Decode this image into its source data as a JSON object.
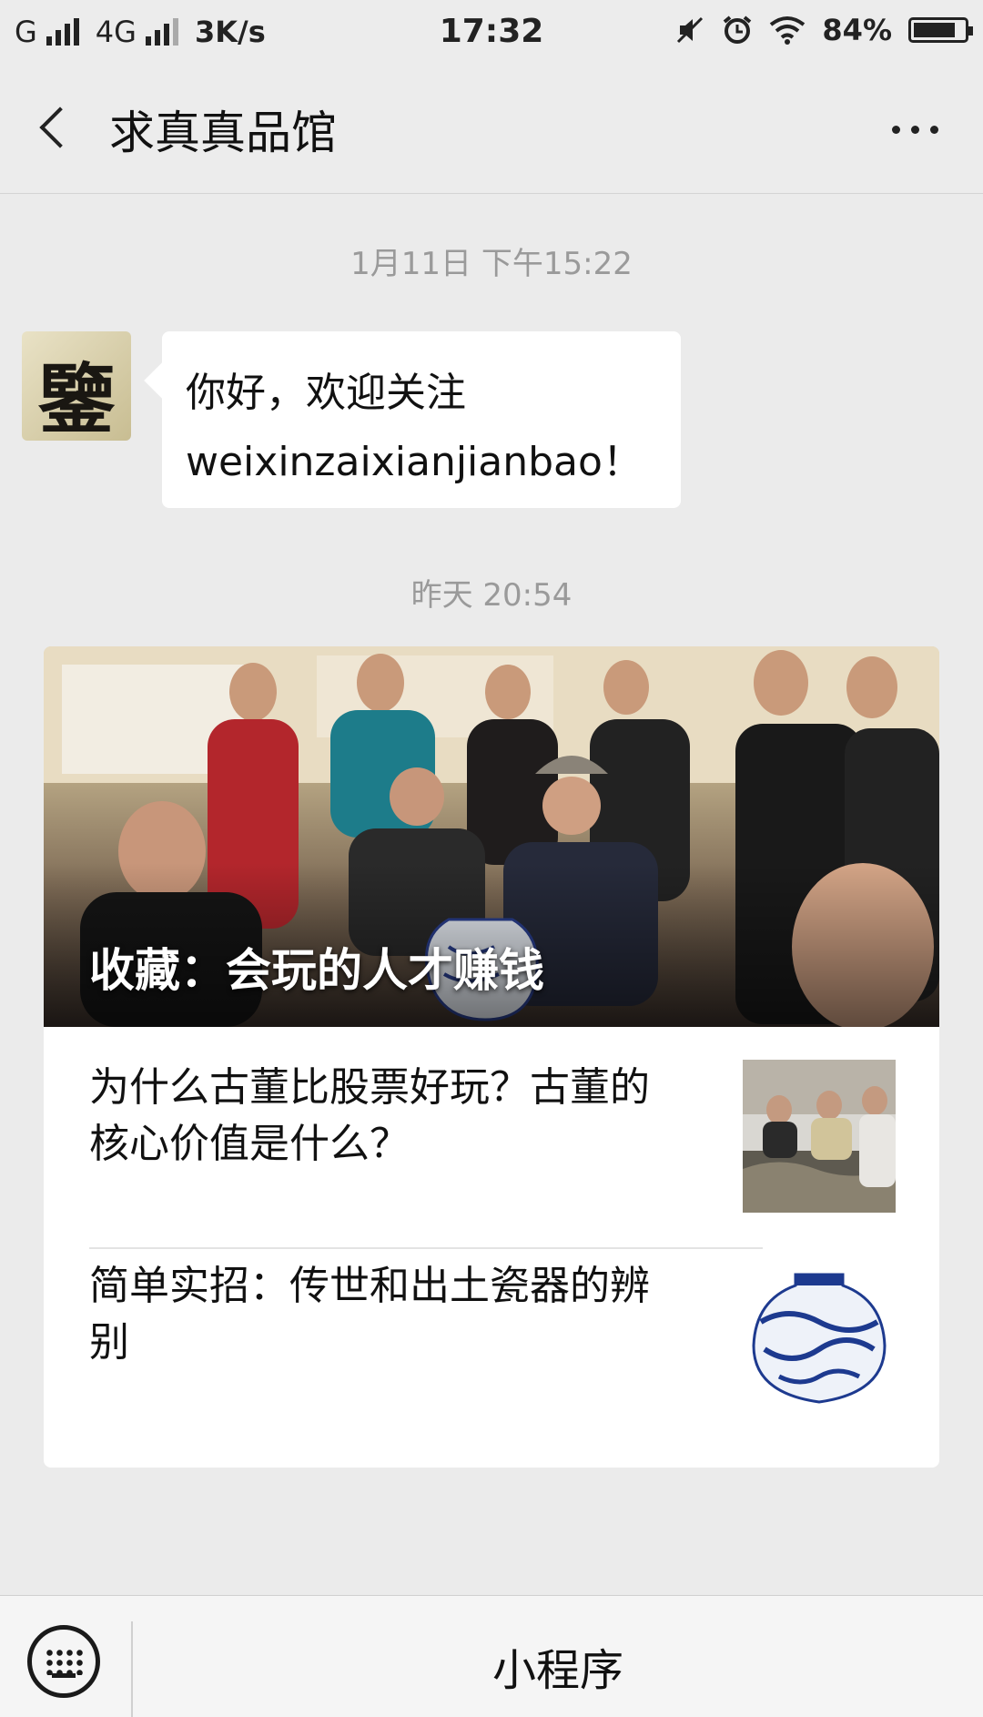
{
  "status_bar": {
    "network_1": "G",
    "network_2": "4G",
    "speed": "3K/s",
    "time": "17:32",
    "battery_percent": "84%",
    "battery_level": 0.84
  },
  "header": {
    "title": "求真真品馆"
  },
  "messages": [
    {
      "timestamp": "1月11日 下午15:22",
      "avatar_text": "鑒",
      "line1": "你好，欢迎关注",
      "line2": "weixinzaixianjianbao！"
    }
  ],
  "article_block": {
    "timestamp": "昨天 20:54",
    "cover_title": "收藏：会玩的人才赚钱",
    "items": [
      {
        "title": "为什么古董比股票好玩？古董的核心价值是什么？",
        "thumb_icon": "painting-appraisal-photo"
      },
      {
        "title": "简单实招：传世和出土瓷器的辨别",
        "thumb_icon": "blue-white-porcelain-jar"
      }
    ]
  },
  "bottom_bar": {
    "keyboard_icon": "keyboard-icon",
    "menu_label": "小程序"
  }
}
